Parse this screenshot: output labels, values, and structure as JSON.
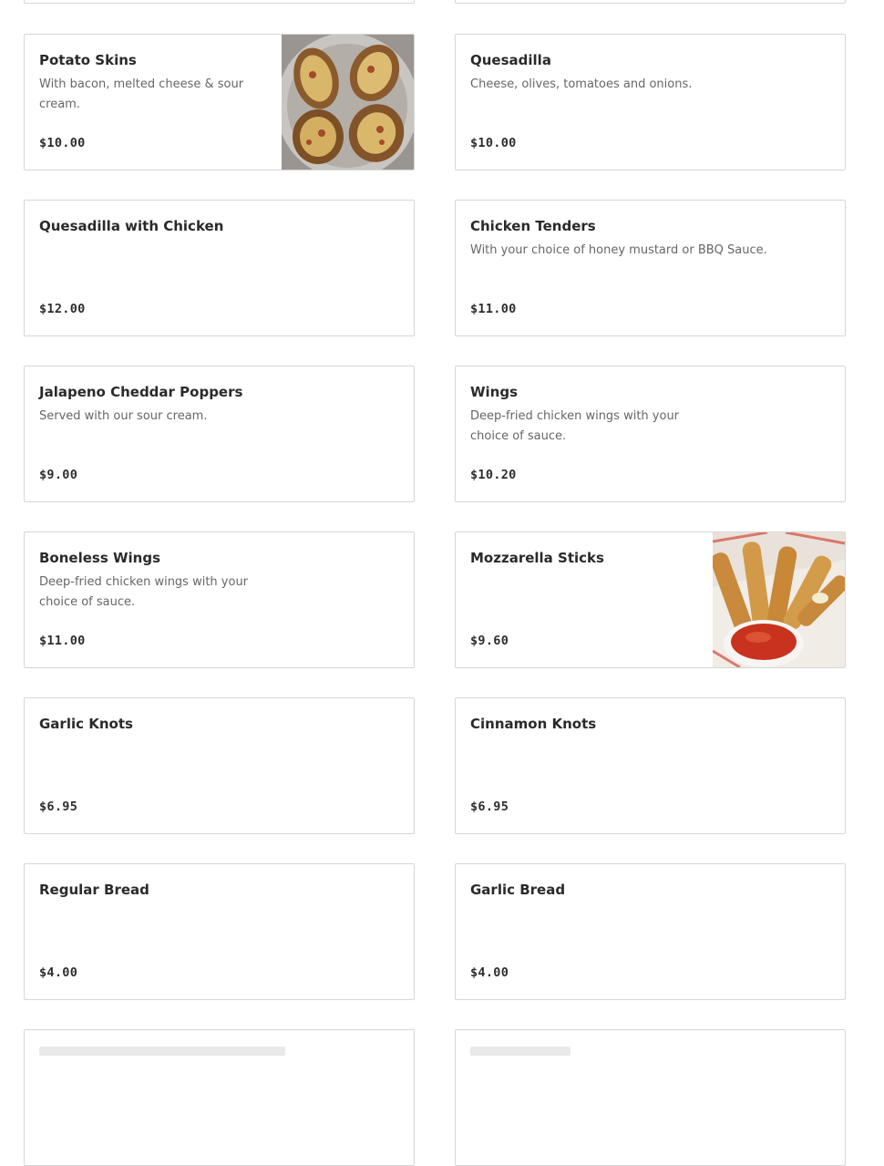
{
  "menu_items": [
    {
      "name": "Potato Skins",
      "description": "With bacon, melted cheese & sour cream.",
      "price": "$10.00",
      "image": "potato-skins-photo"
    },
    {
      "name": "Quesadilla",
      "description": "Cheese, olives, tomatoes and onions.",
      "price": "$10.00"
    },
    {
      "name": "Quesadilla with Chicken",
      "description": "",
      "price": "$12.00"
    },
    {
      "name": "Chicken Tenders",
      "description": "With your choice of honey mustard or BBQ Sauce.",
      "price": "$11.00"
    },
    {
      "name": "Jalapeno Cheddar Poppers",
      "description": "Served with our sour cream.",
      "price": "$9.00"
    },
    {
      "name": "Wings",
      "description": "Deep-fried chicken wings with your choice of sauce.",
      "price": "$10.20"
    },
    {
      "name": "Boneless Wings",
      "description": "Deep-fried chicken wings with your choice of sauce.",
      "price": "$11.00"
    },
    {
      "name": "Mozzarella Sticks",
      "description": "",
      "price": "$9.60",
      "image": "mozzarella-sticks-photo"
    },
    {
      "name": "Garlic Knots",
      "description": "",
      "price": "$6.95"
    },
    {
      "name": "Cinnamon Knots",
      "description": "",
      "price": "$6.95"
    },
    {
      "name": "Regular Bread",
      "description": "",
      "price": "$4.00"
    },
    {
      "name": "Garlic Bread",
      "description": "",
      "price": "$4.00"
    }
  ],
  "colors": {
    "card_border": "#d6d6d6",
    "title_text": "#2a2a2a",
    "description_text": "#666666",
    "price_text": "#2d2d2d"
  }
}
